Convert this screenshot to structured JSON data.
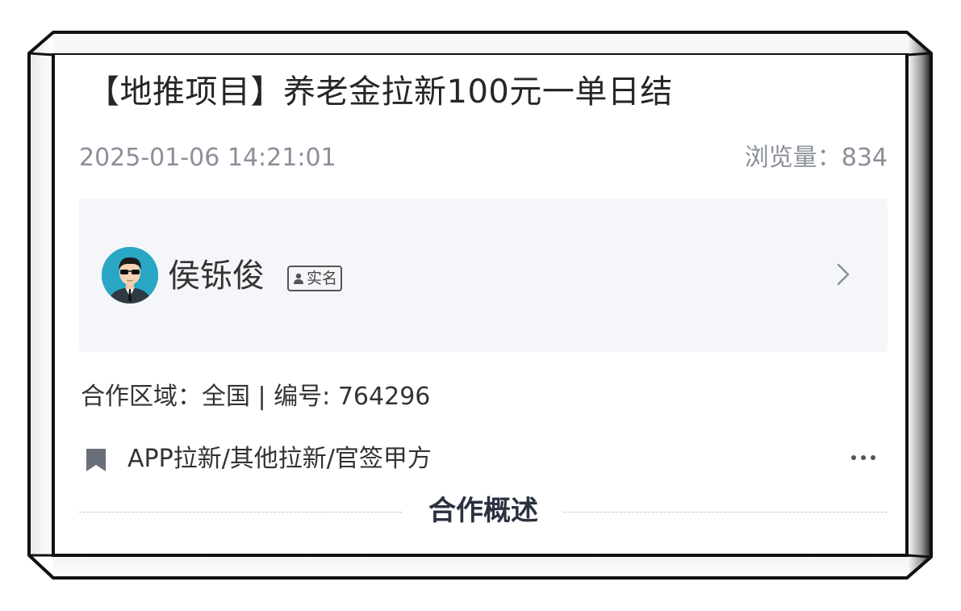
{
  "post": {
    "title": "【地推项目】养老金拉新100元一单日结",
    "date": "2025-01-06 14:21:01",
    "views_label": "浏览量：",
    "views_count": "834"
  },
  "publisher": {
    "name": "侯铄俊",
    "verified_label": "实名",
    "avatar_icon": "person-avatar",
    "chevron_icon": "chevron-right-icon"
  },
  "details": {
    "region_label": "合作区域：",
    "region_value": "全国",
    "separator": " | ",
    "id_label": "编号: ",
    "id_value": "764296",
    "tags": "APP拉新/其他拉新/官签甲方",
    "tag_icon": "bookmark-icon",
    "more_icon": "more-dots-icon"
  },
  "section": {
    "title": "合作概述"
  },
  "colors": {
    "muted_text": "#8a8f99",
    "panel_bg": "#f5f6f9",
    "avatar_bg": "#2aa7c4",
    "heading": "#2b3140"
  }
}
